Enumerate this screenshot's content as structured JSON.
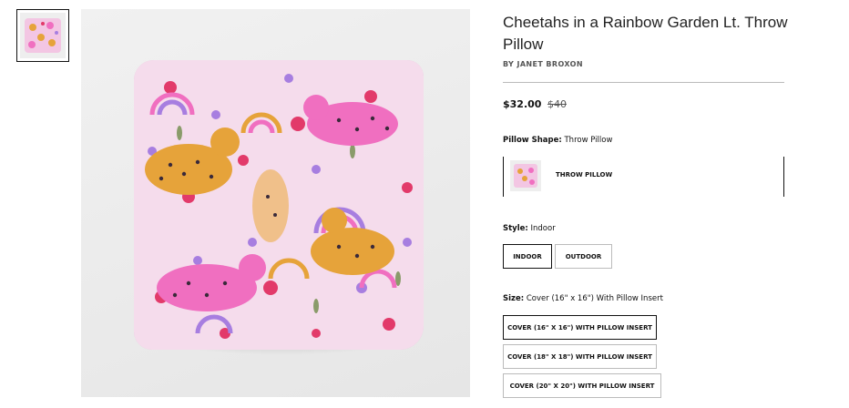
{
  "product": {
    "title": "Cheetahs in a Rainbow Garden Lt. Throw Pillow",
    "byline": "BY JANET BROXON",
    "price_current": "$32.00",
    "price_original": "$40"
  },
  "options": {
    "shape": {
      "label": "Pillow Shape:",
      "value": "Throw Pillow",
      "card_label": "THROW PILLOW"
    },
    "style": {
      "label": "Style:",
      "value": "Indoor",
      "choices": [
        "INDOOR",
        "OUTDOOR"
      ],
      "selected_index": 0
    },
    "size": {
      "label": "Size:",
      "value": "Cover (16\" x 16\") With Pillow Insert",
      "choices": [
        "COVER (16\" X 16\") WITH PILLOW INSERT",
        "COVER (18\" X 18\") WITH PILLOW INSERT",
        "COVER (20\" X 20\") WITH PILLOW INSERT"
      ],
      "selected_index": 0
    }
  },
  "colors": {
    "pillow_base": "#f3d8ea",
    "cheetah_orange": "#e6a33a",
    "cheetah_pink": "#f06fc0",
    "rainbow_purple": "#a77ee0",
    "flower_red": "#e23a6a"
  }
}
